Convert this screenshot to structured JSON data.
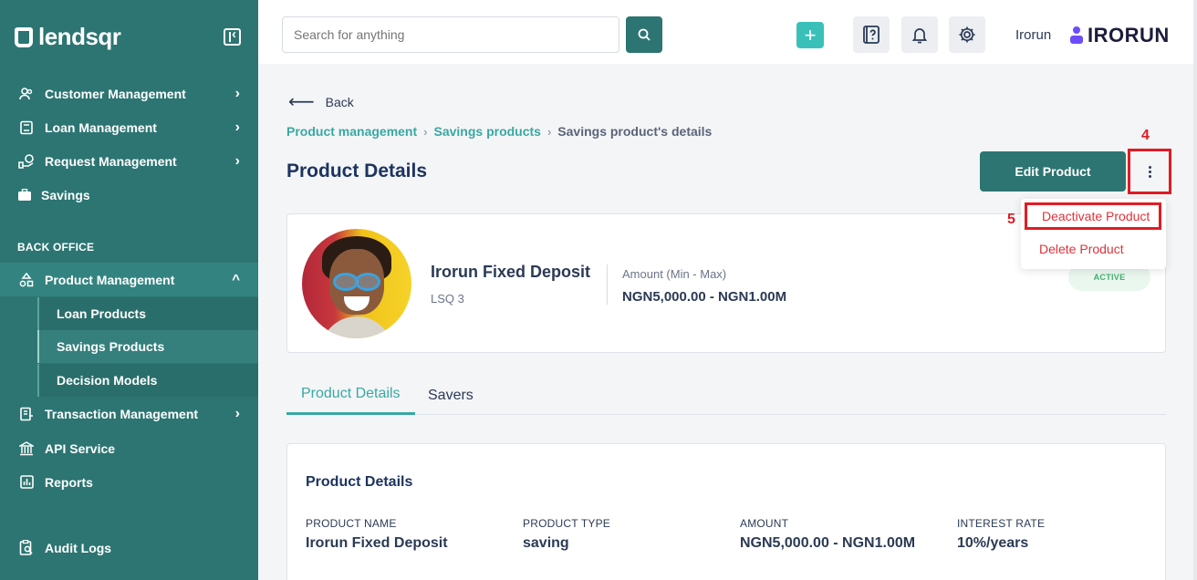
{
  "sidebar": {
    "brand": "lendsqr",
    "items_top": [
      {
        "label": "Customer Management",
        "icon": "users-icon"
      },
      {
        "label": "Loan Management",
        "icon": "loan-icon"
      },
      {
        "label": "Request Management",
        "icon": "request-icon"
      },
      {
        "label": "Savings",
        "icon": "briefcase-icon"
      }
    ],
    "section_label": "BACK OFFICE",
    "product_management": "Product Management",
    "sub_items": [
      "Loan Products",
      "Savings Products",
      "Decision Models"
    ],
    "items_bottom": [
      {
        "label": "Transaction Management",
        "icon": "transaction-icon"
      },
      {
        "label": "API Service",
        "icon": "bank-icon"
      },
      {
        "label": "Reports",
        "icon": "reports-icon"
      },
      {
        "label": "Audit Logs",
        "icon": "audit-icon"
      }
    ]
  },
  "topbar": {
    "search_placeholder": "Search for anything",
    "plus_label": "+",
    "username": "Irorun",
    "org_brand": "IRORUN"
  },
  "main": {
    "back_label": "Back",
    "breadcrumb": [
      "Product management",
      "Savings products",
      "Savings product's details"
    ],
    "page_title": "Product Details",
    "edit_button": "Edit Product",
    "step_4": "4",
    "step_5": "5",
    "menu": [
      "Deactivate Product",
      "Delete Product"
    ],
    "product": {
      "name": "Irorun Fixed Deposit",
      "code": "LSQ 3",
      "amount_label": "Amount (Min - Max)",
      "amount_value": "NGN5,000.00 - NGN1.00M",
      "status": "ACTIVE"
    },
    "tabs": [
      "Product Details",
      "Savers"
    ],
    "details": {
      "title": "Product Details",
      "fields": [
        {
          "label": "PRODUCT NAME",
          "value": "Irorun Fixed Deposit"
        },
        {
          "label": "PRODUCT TYPE",
          "value": "saving"
        },
        {
          "label": "AMOUNT",
          "value": "NGN5,000.00 - NGN1.00M"
        },
        {
          "label": "INTEREST RATE",
          "value": "10%/years"
        }
      ]
    }
  },
  "colors": {
    "sidebar": "#2c7572",
    "accent": "#39a8a2",
    "danger": "#e01c24",
    "active_badge": "#3fb270"
  }
}
